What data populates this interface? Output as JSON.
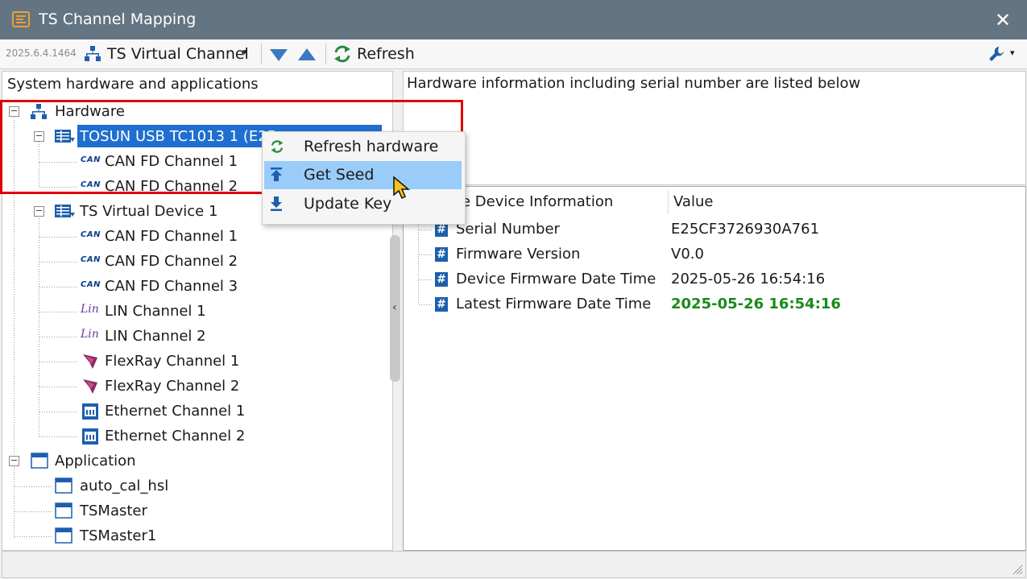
{
  "window": {
    "title": "TS Channel Mapping",
    "close_glyph": "✕"
  },
  "toolbar": {
    "version": "2025.6.4.1464",
    "channel_selector": "TS Virtual Channel",
    "refresh_label": "Refresh",
    "caret": "▾"
  },
  "left_panel": {
    "header": "System hardware and applications",
    "tree": {
      "hardware_label": "Hardware",
      "device1": "TOSUN USB TC1013 1 (E25",
      "device1_channels": [
        "CAN FD Channel 1",
        "CAN FD Channel 2"
      ],
      "device2": "TS Virtual Device 1",
      "device2_channels": [
        {
          "icon": "can-icon",
          "label": "CAN FD Channel 1"
        },
        {
          "icon": "can-icon",
          "label": "CAN FD Channel 2"
        },
        {
          "icon": "can-icon",
          "label": "CAN FD Channel 3"
        },
        {
          "icon": "lin-icon",
          "label": "LIN Channel 1"
        },
        {
          "icon": "lin-icon",
          "label": "LIN Channel 2"
        },
        {
          "icon": "flexray-icon",
          "label": "FlexRay Channel 1"
        },
        {
          "icon": "flexray-icon",
          "label": "FlexRay Channel 2"
        },
        {
          "icon": "ethernet-icon",
          "label": "Ethernet Channel 1"
        },
        {
          "icon": "ethernet-icon",
          "label": "Ethernet Channel 2"
        }
      ],
      "application_label": "Application",
      "applications": [
        "auto_cal_hsl",
        "TSMaster",
        "TSMaster1"
      ],
      "expander_glyph": "−",
      "can_icon_text": "CAN",
      "lin_icon_text": "Lin"
    }
  },
  "right_panel": {
    "info_text": "Hardware information including serial number are listed below",
    "columns": [
      "re Device Information",
      "Value"
    ],
    "rows": [
      {
        "name": "Serial Number",
        "value": "E25CF3726930A761"
      },
      {
        "name": "Firmware Version",
        "value": "V0.0"
      },
      {
        "name": "Device Firmware Date Time",
        "value": "2025-05-26 16:54:16"
      },
      {
        "name": "Latest Firmware Date Time",
        "value": "2025-05-26 16:54:16"
      }
    ],
    "hash_glyph": "#",
    "latest_value_color": "#1a8a1a"
  },
  "context_menu": {
    "items": [
      "Refresh hardware",
      "Get Seed",
      "Update Key"
    ],
    "hovered": "Get Seed"
  },
  "splitter_glyph": "‹",
  "colors": {
    "titlebar": "#637482",
    "selection": "#1f6fd0",
    "menu_hover": "#99ccf9",
    "highlight": "#e00000"
  }
}
